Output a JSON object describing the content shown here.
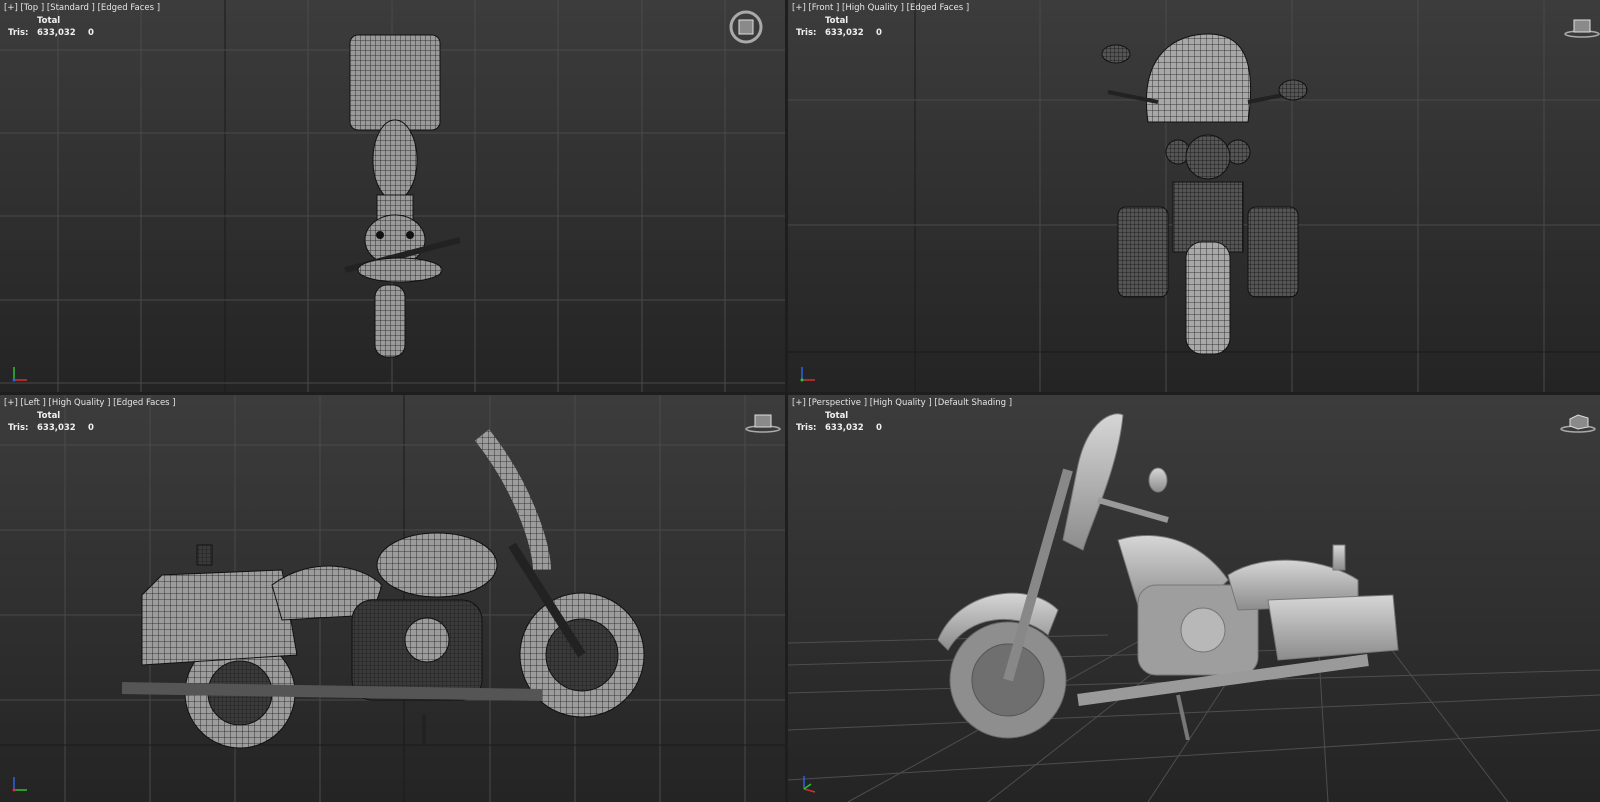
{
  "viewports": [
    {
      "id": "top",
      "labels": [
        "[+]",
        "[Top ]",
        "[Standard ]",
        "[Edged Faces ]"
      ],
      "stats": {
        "header": "Total",
        "label": "Tris:",
        "value": "633,032",
        "selected": "0"
      },
      "navicon": "viewcube-icon"
    },
    {
      "id": "front",
      "labels": [
        "[+]",
        "[Front ]",
        "[High Quality ]",
        "[Edged Faces ]"
      ],
      "stats": {
        "header": "Total",
        "label": "Tris:",
        "value": "633,032",
        "selected": "0"
      },
      "navicon": "viewcube-icon"
    },
    {
      "id": "left",
      "labels": [
        "[+]",
        "[Left ]",
        "[High Quality ]",
        "[Edged Faces ]"
      ],
      "stats": {
        "header": "Total",
        "label": "Tris:",
        "value": "633,032",
        "selected": "0"
      },
      "navicon": "viewcube-icon"
    },
    {
      "id": "perspective",
      "labels": [
        "[+]",
        "[Perspective ]",
        "[High Quality ]",
        "[Default Shading ]"
      ],
      "stats": {
        "header": "Total",
        "label": "Tris:",
        "value": "633,032",
        "selected": "0"
      },
      "navicon": "viewcube-icon",
      "active": true
    }
  ],
  "colors": {
    "active_border": "#c8b45a",
    "axis_x": "#d03030",
    "axis_y": "#30c030",
    "axis_z": "#3060e0",
    "wireframe": "#111111",
    "shaded_model": "#b9b9b9"
  }
}
